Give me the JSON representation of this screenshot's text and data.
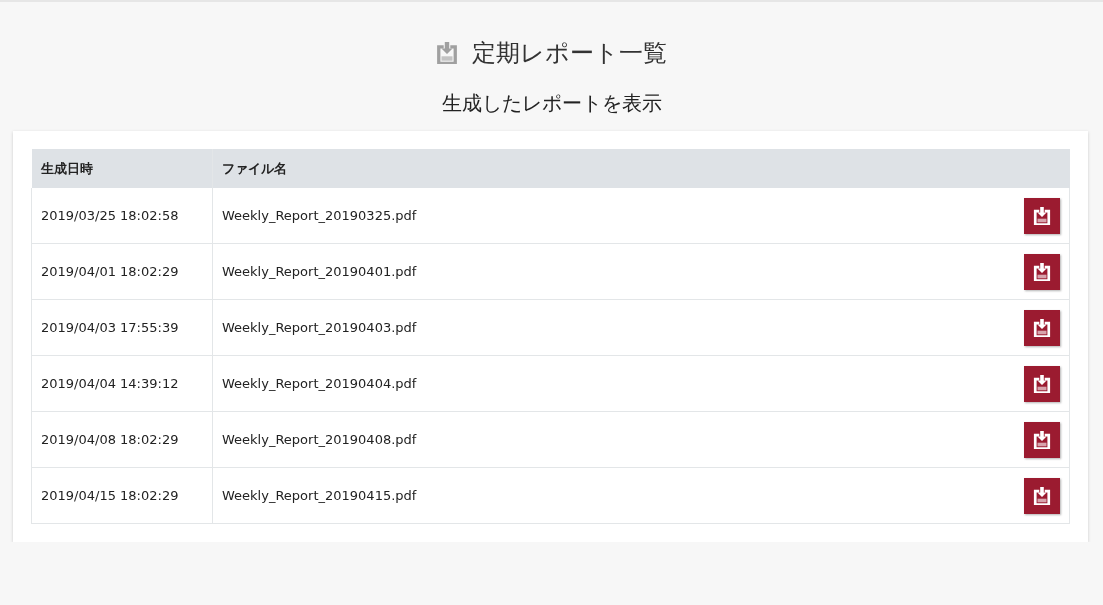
{
  "page": {
    "title": "定期レポート一覧",
    "subtitle": "生成したレポートを表示"
  },
  "table": {
    "columns": [
      "生成日時",
      "ファイル名"
    ],
    "rows": [
      {
        "generated_at": "2019/03/25 18:02:58",
        "file_name": "Weekly_Report_20190325.pdf"
      },
      {
        "generated_at": "2019/04/01 18:02:29",
        "file_name": "Weekly_Report_20190401.pdf"
      },
      {
        "generated_at": "2019/04/03 17:55:39",
        "file_name": "Weekly_Report_20190403.pdf"
      },
      {
        "generated_at": "2019/04/04 14:39:12",
        "file_name": "Weekly_Report_20190404.pdf"
      },
      {
        "generated_at": "2019/04/08 18:02:29",
        "file_name": "Weekly_Report_20190408.pdf"
      },
      {
        "generated_at": "2019/04/15 18:02:29",
        "file_name": "Weekly_Report_20190415.pdf"
      }
    ]
  }
}
